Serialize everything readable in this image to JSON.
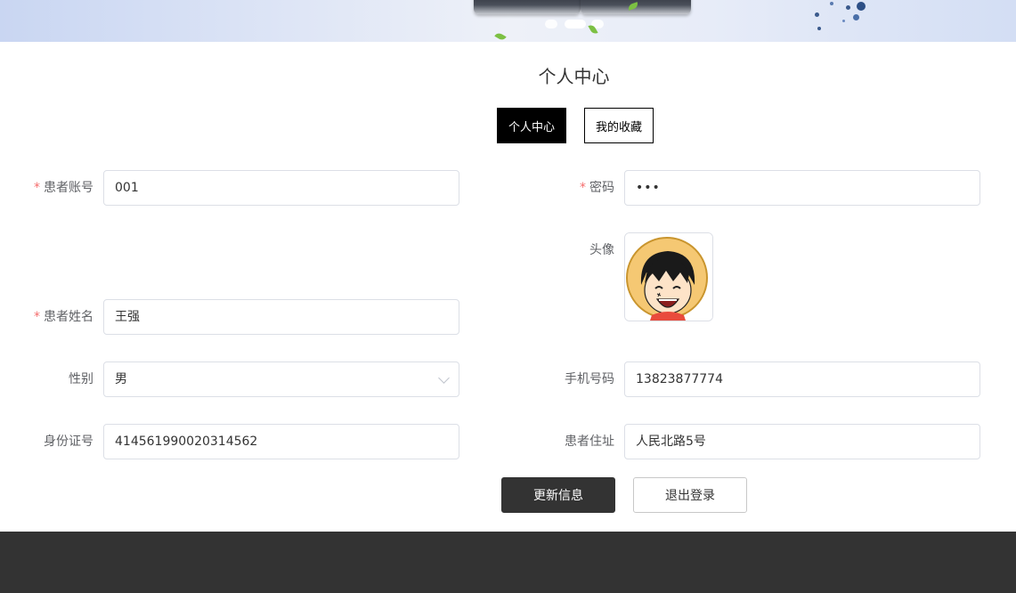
{
  "page": {
    "title": "个人中心"
  },
  "tabs": [
    {
      "label": "个人中心",
      "active": true
    },
    {
      "label": "我的收藏",
      "active": false
    }
  ],
  "form": {
    "account": {
      "label": "患者账号",
      "value": "001",
      "required": true
    },
    "password": {
      "label": "密码",
      "value": "•••",
      "required": true
    },
    "avatar": {
      "label": "头像"
    },
    "name": {
      "label": "患者姓名",
      "value": "王强",
      "required": true
    },
    "gender": {
      "label": "性别",
      "value": "男"
    },
    "phone": {
      "label": "手机号码",
      "value": "13823877774"
    },
    "id_card": {
      "label": "身份证号",
      "value": "414561990020314562"
    },
    "address": {
      "label": "患者住址",
      "value": "人民北路5号"
    }
  },
  "buttons": {
    "update": "更新信息",
    "logout": "退出登录"
  },
  "colors": {
    "primary": "#333333",
    "required": "#f56c6c",
    "border": "#dcdfe6",
    "footer": "#333333"
  },
  "icons": {
    "select": "chevron-down-icon",
    "avatar": "cartoon-avatar-image"
  }
}
